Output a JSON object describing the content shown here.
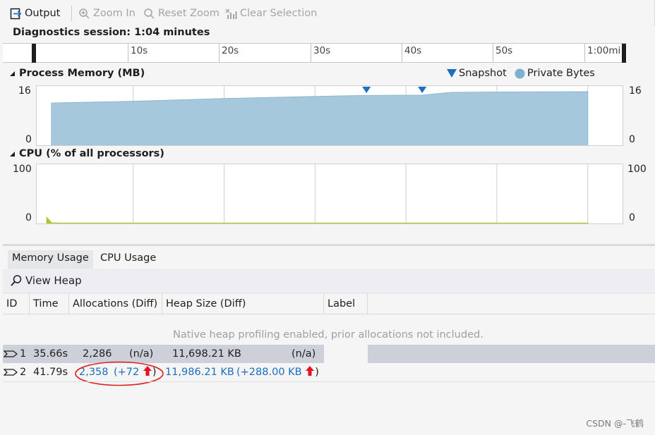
{
  "toolbar": {
    "output_label": "Output",
    "zoom_in_label": "Zoom In",
    "reset_zoom_label": "Reset Zoom",
    "clear_selection_label": "Clear Selection"
  },
  "session": {
    "title": "Diagnostics session: 1:04 minutes"
  },
  "ruler": {
    "labels": [
      "10s",
      "20s",
      "30s",
      "40s",
      "50s",
      "1:00mi"
    ]
  },
  "memory_chart": {
    "title": "Process Memory (MB)",
    "y_max": "16",
    "y_min": "0",
    "legend_snapshot": "Snapshot",
    "legend_private": "Private Bytes",
    "colors": {
      "area": "#a6c8dc",
      "snapshot_marker": "#1c6ec0",
      "private_bytes": "#7eb1cf"
    }
  },
  "cpu_chart": {
    "title": "CPU (% of all processors)",
    "y_max": "100",
    "y_min": "0",
    "colors": {
      "line": "#a8c82a"
    }
  },
  "chart_data": [
    {
      "type": "area",
      "title": "Process Memory (MB)",
      "xlabel": "",
      "ylabel": "",
      "x": [
        1,
        10,
        20,
        30,
        35.66,
        41.79,
        45,
        50,
        60
      ],
      "series": [
        {
          "name": "Private Bytes",
          "values": [
            12.5,
            13.0,
            13.8,
            14.4,
            14.7,
            14.8,
            15.6,
            15.7,
            15.8
          ]
        }
      ],
      "snapshots_at": [
        35.66,
        41.79
      ],
      "ylim": [
        0,
        16
      ],
      "grid": true,
      "legend": "top-right"
    },
    {
      "type": "line",
      "title": "CPU (% of all processors)",
      "xlabel": "",
      "ylabel": "",
      "x": [
        0.5,
        1,
        2,
        60
      ],
      "series": [
        {
          "name": "",
          "values": [
            10,
            1,
            0.5,
            0.5
          ]
        }
      ],
      "ylim": [
        0,
        100
      ],
      "grid": true
    }
  ],
  "tabs": {
    "memory_usage": "Memory Usage",
    "cpu_usage": "CPU Usage"
  },
  "view_heap_label": "View Heap",
  "table": {
    "headers": {
      "id": "ID",
      "time": "Time",
      "allocations": "Allocations (Diff)",
      "heap_size": "Heap Size (Diff)",
      "label": "Label"
    },
    "info_message": "Native heap profiling enabled, prior allocations not included.",
    "rows": [
      {
        "id": "1",
        "time": "35.66s",
        "allocations": "2,286",
        "alloc_diff": "(n/a)",
        "heap_size": "11,698.21 KB",
        "heap_diff": "(n/a)"
      },
      {
        "id": "2",
        "time": "41.79s",
        "allocations": "2,358",
        "alloc_diff_open": "(+72",
        "alloc_diff_close": ")",
        "heap_size": "11,986.21 KB",
        "heap_diff_open": "(+288.00 KB",
        "heap_diff_close": ")"
      }
    ]
  },
  "watermark": "CSDN @-飞鹤"
}
